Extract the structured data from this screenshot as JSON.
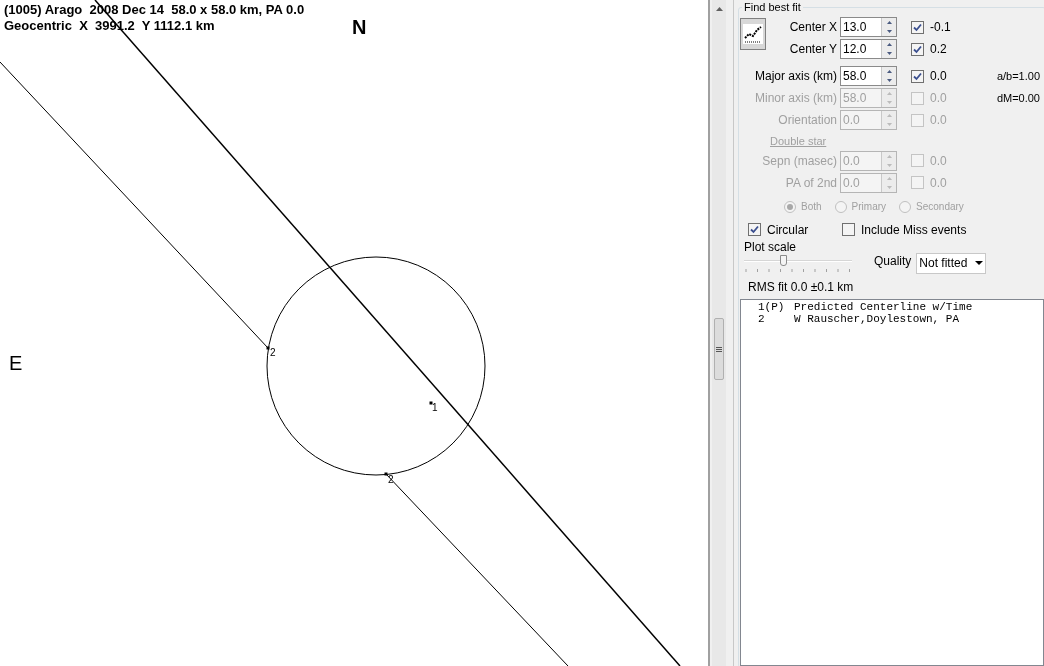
{
  "plot": {
    "header_lines": [
      "(1005) Arago  2008 Dec 14  58.0 x 58.0 km, PA 0.0",
      "Geocentric  X  3991.2  Y 1112.1 km"
    ],
    "directions": [
      {
        "kind": "north",
        "label": "N"
      },
      {
        "kind": "east",
        "label": "E"
      }
    ],
    "chords": [
      {
        "label": "1",
        "kind": "centerline"
      },
      {
        "label": "2",
        "kind": "upper"
      },
      {
        "label": "2",
        "kind": "lower"
      }
    ]
  },
  "fit_panel": {
    "title": "Find best fit",
    "params": [
      {
        "label": "Center X",
        "value": "13.0",
        "checked": true,
        "residual": "-0.1",
        "disabled": false
      },
      {
        "label": "Center Y",
        "value": "12.0",
        "checked": true,
        "residual": "0.2",
        "disabled": false
      },
      {
        "label": "Major axis (km)",
        "value": "58.0",
        "checked": true,
        "residual": "0.0",
        "disabled": false,
        "note": "a/b=1.00"
      },
      {
        "label": "Minor axis (km)",
        "value": "58.0",
        "checked": false,
        "residual": "0.0",
        "disabled": true,
        "note": "dM=0.00"
      },
      {
        "label": "Orientation",
        "value": "0.0",
        "checked": false,
        "residual": "0.0",
        "disabled": true
      }
    ],
    "double_star": {
      "heading": "Double star",
      "params": [
        {
          "label": "Sepn (masec)",
          "value": "0.0",
          "checked": false,
          "residual": "0.0",
          "disabled": true
        },
        {
          "label": "PA of 2nd",
          "value": "0.0",
          "checked": false,
          "residual": "0.0",
          "disabled": true
        }
      ],
      "radios": [
        {
          "label": "Both",
          "selected": true,
          "disabled": true
        },
        {
          "label": "Primary",
          "selected": false,
          "disabled": true
        },
        {
          "label": "Secondary",
          "selected": false,
          "disabled": true
        }
      ]
    },
    "options": [
      {
        "label": "Circular",
        "checked": true
      },
      {
        "label": "Include Miss events",
        "checked": false
      }
    ],
    "plot_scale": {
      "label": "Plot scale",
      "level": 0.36
    },
    "quality": {
      "label": "Quality",
      "value": "Not fitted"
    },
    "rms": "RMS fit 0.0 ±0.1 km",
    "observers": [
      {
        "number": "1(P)",
        "name": "Predicted Centerline w/Time"
      },
      {
        "number": "2",
        "name": "W Rauscher,Doylestown, PA"
      }
    ]
  }
}
